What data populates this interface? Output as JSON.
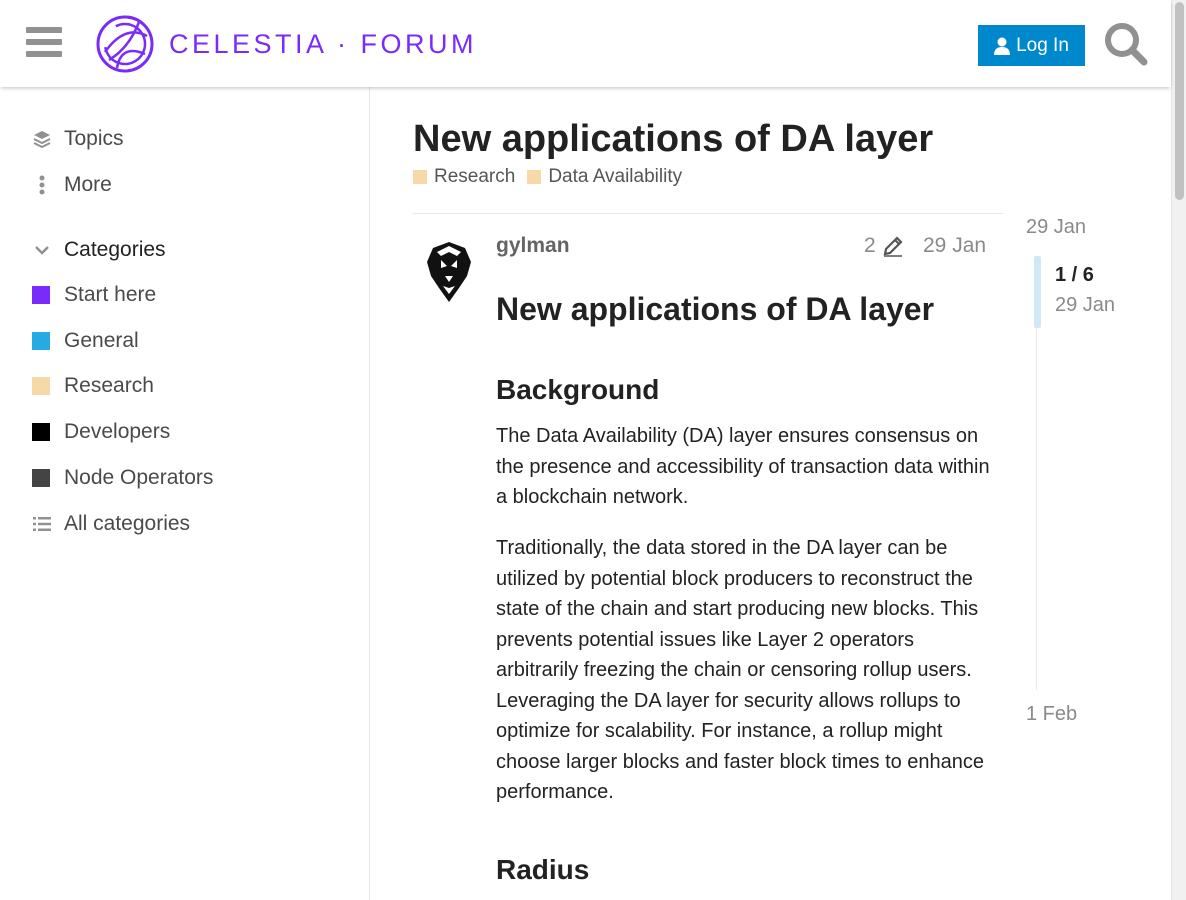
{
  "header": {
    "logo_text": "CELESTIA · FORUM",
    "login_label": "Log In",
    "colors": {
      "brand": "#7b2bf9",
      "login_bg": "#0088cc"
    }
  },
  "sidebar": {
    "topics_label": "Topics",
    "more_label": "More",
    "categories_heading": "Categories",
    "categories": [
      {
        "label": "Start here",
        "color": "#7b2bf9"
      },
      {
        "label": "General",
        "color": "#25aae1"
      },
      {
        "label": "Research",
        "color": "#f7d9a8"
      },
      {
        "label": "Developers",
        "color": "#000000"
      },
      {
        "label": "Node Operators",
        "color": "#444444"
      }
    ],
    "all_categories_label": "All categories"
  },
  "topic": {
    "title": "New applications of DA layer",
    "tags": [
      {
        "label": "Research",
        "color": "#f7d9a8"
      },
      {
        "label": "Data Availability",
        "color": "#f7d9a8"
      }
    ]
  },
  "post": {
    "author": "gylman",
    "edit_count": "2",
    "date": "29 Jan",
    "heading": "New applications of DA layer",
    "section_1_title": "Background",
    "paragraph_1": "The Data Availability (DA) layer ensures consensus on the presence and accessibility of transaction data within a blockchain network.",
    "paragraph_2": "Traditionally, the data stored in the DA layer can be utilized by potential block producers to reconstruct the state of the chain and start producing new blocks. This prevents potential issues like Layer 2 operators arbitrarily freezing the chain or censoring rollup users. Leveraging the DA layer for security allows rollups to optimize for scalability. For instance, a rollup might choose larger blocks and faster block times to enhance performance.",
    "section_2_title": "Radius"
  },
  "timeline": {
    "start_date": "29 Jan",
    "position": "1 / 6",
    "position_date": "29 Jan",
    "end_date": "1 Feb"
  }
}
